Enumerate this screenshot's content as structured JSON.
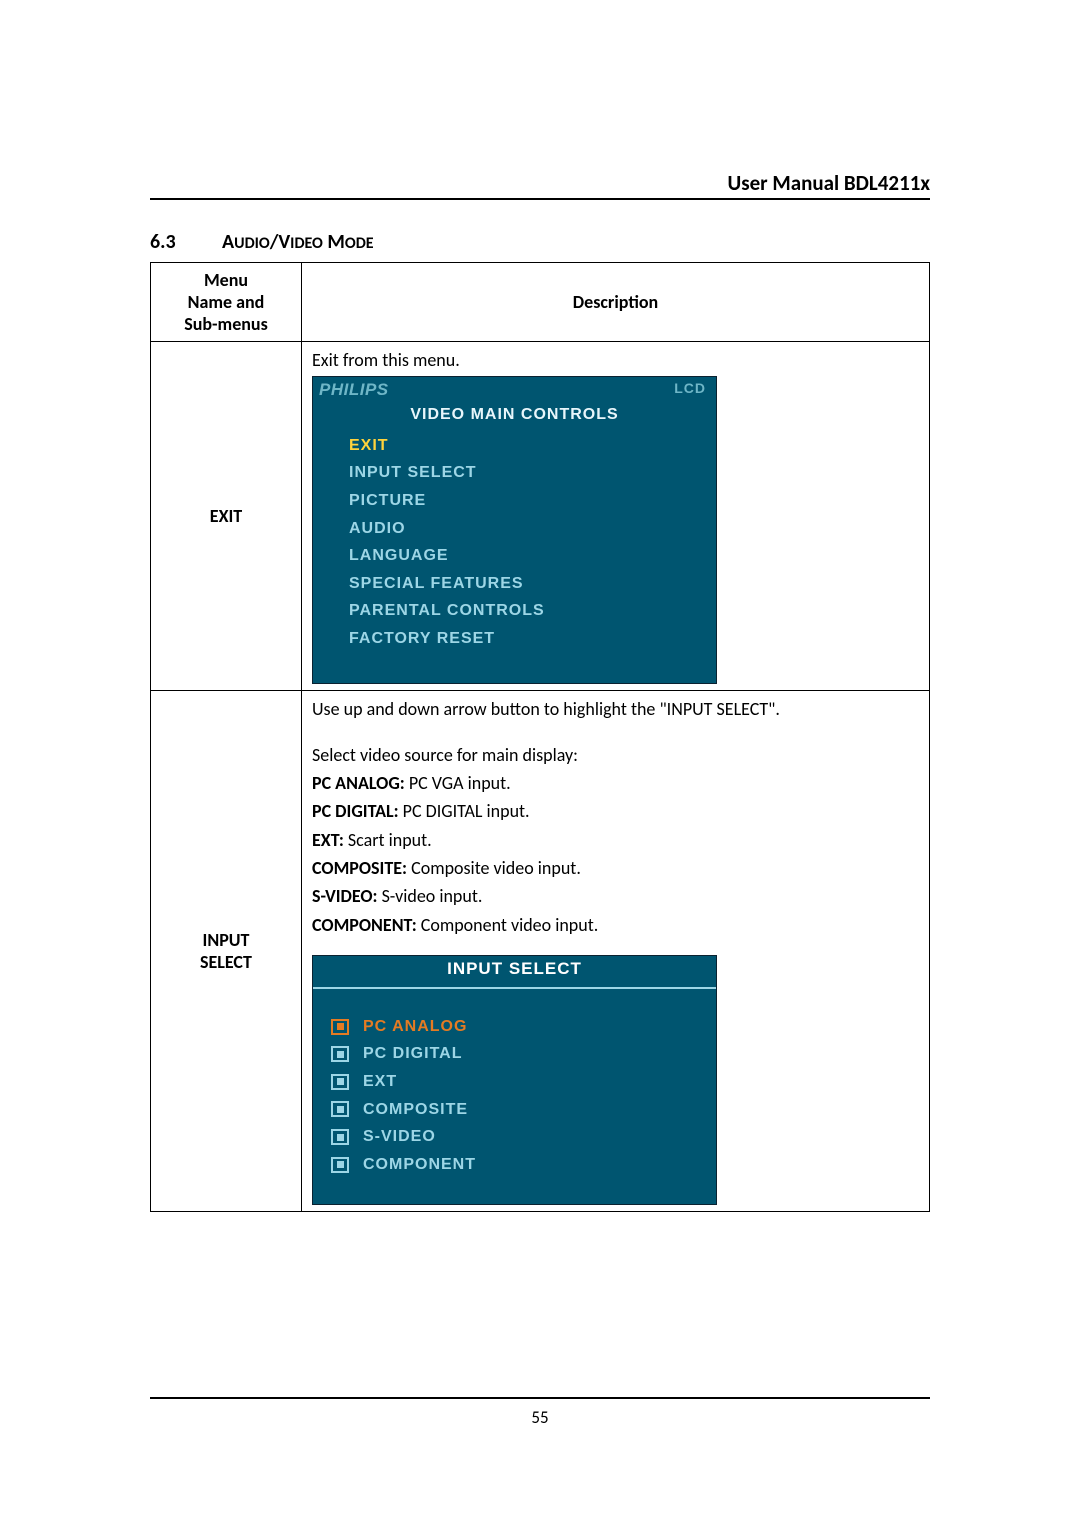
{
  "header": {
    "title": "User Manual BDL4211x"
  },
  "section": {
    "number": "6.3",
    "title_prefix": "A",
    "title_mid1": "UDIO",
    "title_slash": "/V",
    "title_mid2": "IDEO",
    "title_sp": " M",
    "title_end": "ODE"
  },
  "table": {
    "col1_header_l1": "Menu",
    "col1_header_l2": "Name and",
    "col1_header_l3": "Sub-menus",
    "col2_header": "Description",
    "row1": {
      "menu": "EXIT",
      "desc_line": "Exit from this menu.",
      "osd": {
        "brand": "PHILIPS",
        "badge": "LCD",
        "title": "VIDEO MAIN CONTROLS",
        "items": [
          {
            "label": "EXIT",
            "highlight": true
          },
          {
            "label": "INPUT SELECT",
            "highlight": false
          },
          {
            "label": "PICTURE",
            "highlight": false
          },
          {
            "label": "AUDIO",
            "highlight": false
          },
          {
            "label": "LANGUAGE",
            "highlight": false
          },
          {
            "label": "SPECIAL FEATURES",
            "highlight": false
          },
          {
            "label": "PARENTAL CONTROLS",
            "highlight": false
          },
          {
            "label": "FACTORY RESET",
            "highlight": false
          }
        ]
      }
    },
    "row2": {
      "menu_l1": "INPUT",
      "menu_l2": "SELECT",
      "desc_intro": "Use up and down arrow button to highlight the \"INPUT SELECT\".",
      "desc_sub": "Select video source for main display:",
      "lines": [
        {
          "b": "PC ANALOG:",
          "t": " PC VGA input."
        },
        {
          "b": "PC DIGITAL:",
          "t": " PC DIGITAL input."
        },
        {
          "b": "EXT:",
          "t": " Scart input."
        },
        {
          "b": "COMPOSITE:",
          "t": " Composite video input."
        },
        {
          "b": "S-VIDEO:",
          "t": " S-video input."
        },
        {
          "b": "COMPONENT:",
          "t": " Component video input."
        }
      ],
      "osd": {
        "title": "INPUT SELECT",
        "items": [
          {
            "label": "PC ANALOG",
            "highlight": true
          },
          {
            "label": "PC DIGITAL",
            "highlight": false
          },
          {
            "label": "EXT",
            "highlight": false
          },
          {
            "label": "COMPOSITE",
            "highlight": false
          },
          {
            "label": "S-VIDEO",
            "highlight": false
          },
          {
            "label": "COMPONENT",
            "highlight": false
          }
        ]
      }
    }
  },
  "footer": {
    "page_number": "55"
  }
}
